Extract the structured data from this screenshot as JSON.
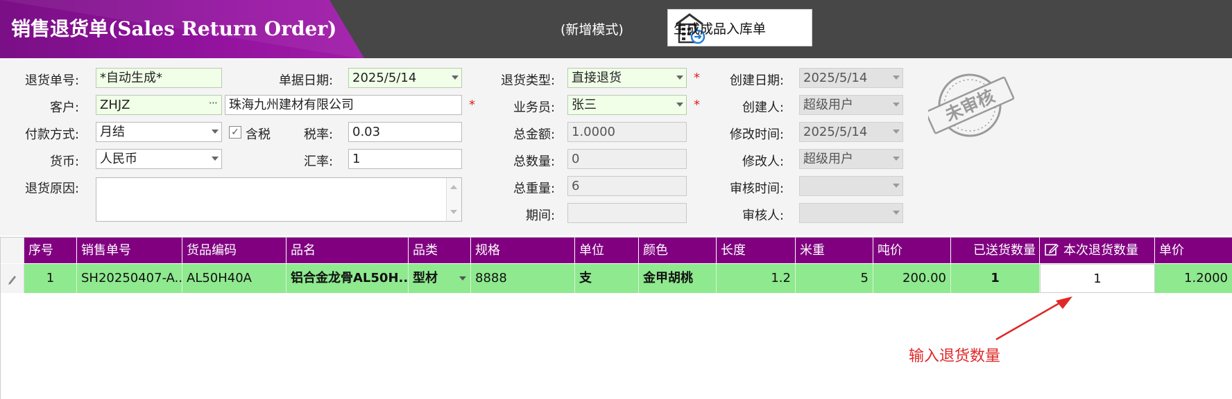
{
  "header": {
    "title": "销售退货单(Sales Return Order)",
    "mode": "(新增模式)",
    "generate_button": "生成成品入库单"
  },
  "form": {
    "return_no": {
      "label": "退货单号:",
      "value": "*自动生成*"
    },
    "doc_date": {
      "label": "单据日期:",
      "value": "2025/5/14"
    },
    "return_type": {
      "label": "退货类型:",
      "value": "直接退货"
    },
    "create_date": {
      "label": "创建日期:",
      "value": "2025/5/14"
    },
    "customer": {
      "label": "客户:",
      "code": "ZHJZ",
      "name": "珠海九州建材有限公司"
    },
    "salesman": {
      "label": "业务员:",
      "value": "张三"
    },
    "creator": {
      "label": "创建人:",
      "value": "超级用户"
    },
    "payment": {
      "label": "付款方式:",
      "value": "月结"
    },
    "tax_included": {
      "label": "含税",
      "checked": true
    },
    "tax_rate": {
      "label": "税率:",
      "value": "0.03"
    },
    "total_amount": {
      "label": "总金额:",
      "value": "1.0000"
    },
    "modify_time": {
      "label": "修改时间:",
      "value": "2025/5/14"
    },
    "currency": {
      "label": "货币:",
      "value": "人民币"
    },
    "exchange_rate": {
      "label": "汇率:",
      "value": "1"
    },
    "total_qty": {
      "label": "总数量:",
      "value": "0"
    },
    "modifier": {
      "label": "修改人:",
      "value": "超级用户"
    },
    "reason": {
      "label": "退货原因:",
      "value": ""
    },
    "total_weight": {
      "label": "总重量:",
      "value": "6"
    },
    "audit_time": {
      "label": "审核时间:",
      "value": ""
    },
    "period": {
      "label": "期间:",
      "value": ""
    },
    "auditor": {
      "label": "审核人:",
      "value": ""
    },
    "required_mark": "*",
    "stamp_text": "未审核"
  },
  "grid": {
    "columns": [
      "序号",
      "销售单号",
      "货品编码",
      "品名",
      "品类",
      "规格",
      "单位",
      "颜色",
      "长度",
      "米重",
      "吨价",
      "已送货数量",
      "本次退货数量",
      "单价"
    ],
    "rows": [
      [
        "1",
        "SH20250407-A...",
        "AL50H40A",
        "铝合金龙骨AL50H...",
        "型材",
        "8888",
        "支",
        "金甲胡桃",
        "1.2",
        "5",
        "200.00",
        "1",
        "1",
        "1.2000"
      ]
    ]
  },
  "annotation": {
    "text": "输入退货数量",
    "color": "#e02828"
  },
  "colors": {
    "title_bar": "#8b1196",
    "header_bg": "#474747",
    "grid_header": "#800080",
    "row_highlight": "#8fe98f"
  }
}
